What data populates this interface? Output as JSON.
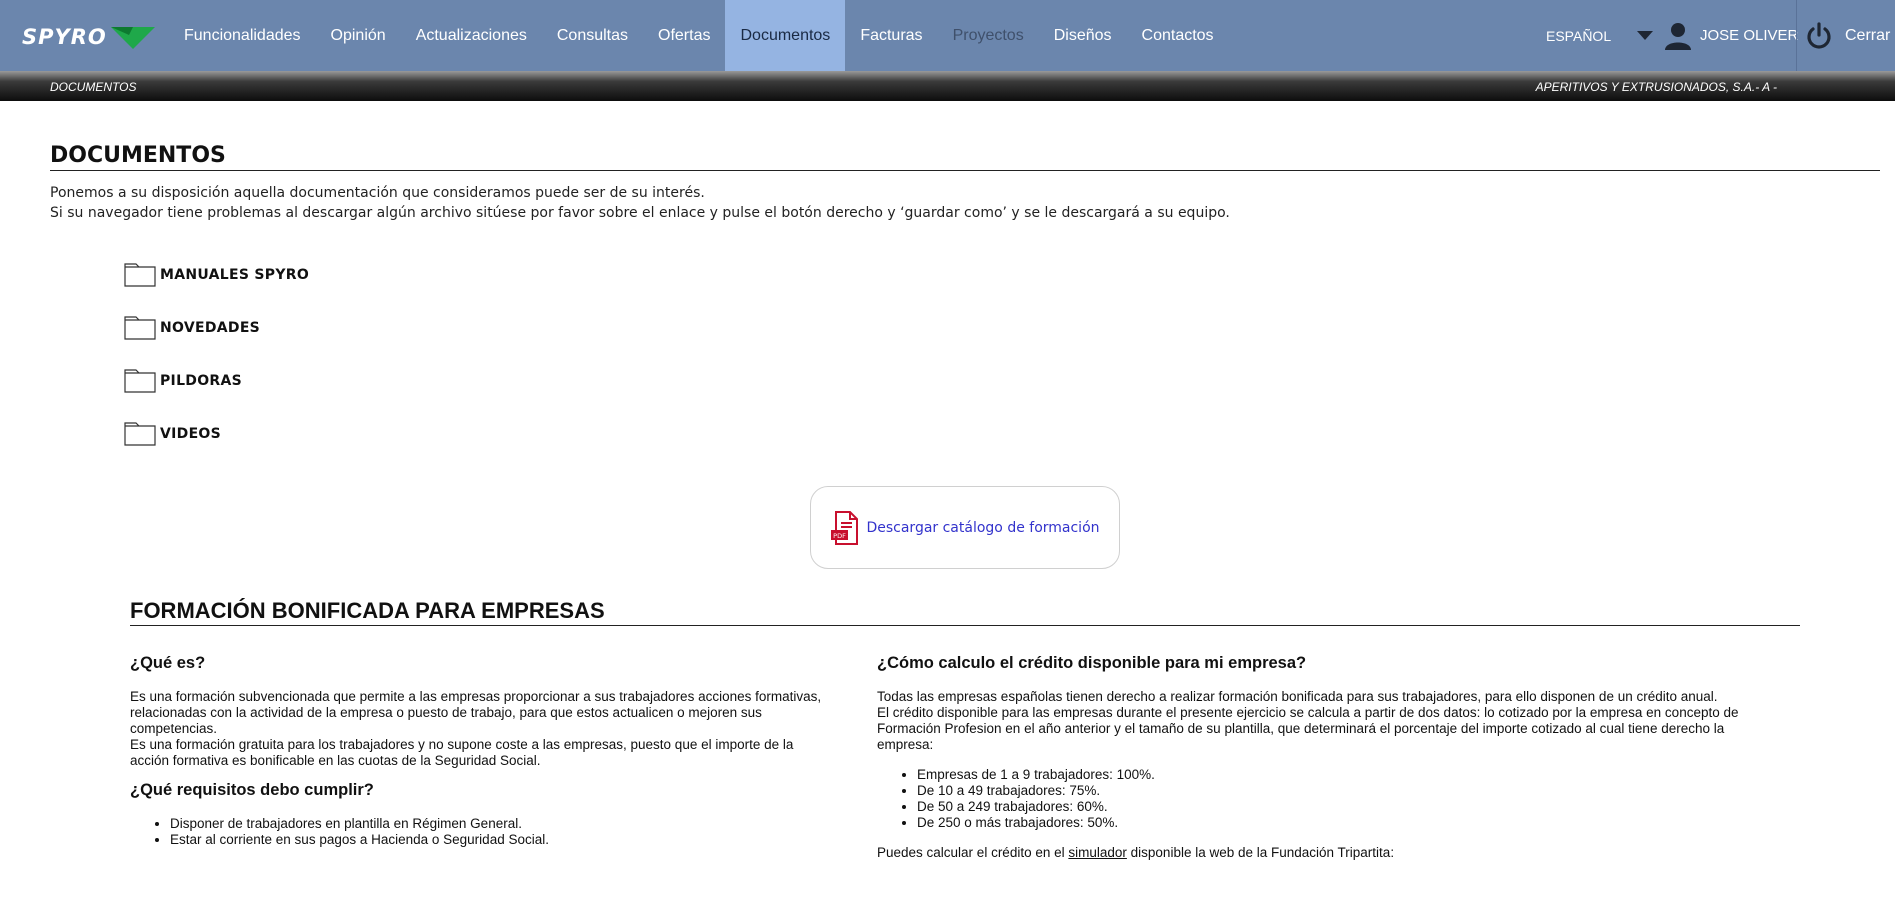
{
  "header": {
    "logo_text": "SPYRO",
    "nav": [
      {
        "label": "Funcionalidades"
      },
      {
        "label": "Opinión"
      },
      {
        "label": "Actualizaciones"
      },
      {
        "label": "Consultas"
      },
      {
        "label": "Ofertas"
      },
      {
        "label": "Documentos",
        "active": true
      },
      {
        "label": "Facturas"
      },
      {
        "label": "Proyectos",
        "muted": true
      },
      {
        "label": "Diseños"
      },
      {
        "label": "Contactos"
      }
    ],
    "language": "ESPAÑOL",
    "user_name": "JOSE OLIVER",
    "logout_label": "Cerrar"
  },
  "strip": {
    "section": "DOCUMENTOS",
    "company": "APERITIVOS Y EXTRUSIONADOS, S.A.- A -"
  },
  "page": {
    "title": "DOCUMENTOS",
    "intro_line1": "Ponemos a su disposición aquella documentación que consideramos puede ser de su interés.",
    "intro_line2": "Si su navegador tiene problemas al descargar algún archivo sitúese por favor sobre el enlace y pulse el botón derecho y ‘guardar como’ y se le descargará a su equipo."
  },
  "folders": [
    "MANUALES SPYRO",
    "NOVEDADES",
    "PILDORAS",
    "VIDEOS"
  ],
  "download": {
    "icon": "pdf-icon",
    "label": "Descargar catálogo de formación"
  },
  "formacion": {
    "title": "FORMACIÓN BONIFICADA PARA EMPRESAS",
    "left": {
      "q1": "¿Qué es?",
      "p1": "Es una formación subvencionada que permite a las empresas proporcionar a sus trabajadores acciones formativas, relacionadas con la actividad de la empresa o puesto de trabajo, para que estos actualicen o mejoren sus competencias.",
      "p2": "Es una formación gratuita para los trabajadores y no supone coste a las empresas, puesto que el importe de la acción formativa es bonificable en las cuotas de la Seguridad Social.",
      "q2": "¿Qué requisitos debo cumplir?",
      "requirements": [
        "Disponer de trabajadores en plantilla en Régimen General.",
        "Estar al corriente en sus pagos a Hacienda o Seguridad Social."
      ]
    },
    "right": {
      "q1": "¿Cómo calculo el crédito disponible para mi empresa?",
      "p1": "Todas las empresas españolas tienen derecho a realizar formación bonificada para sus trabajadores, para ello disponen de un crédito anual.",
      "p2": "El crédito disponible para las empresas durante el presente ejercicio se calcula a partir de dos datos: lo cotizado por la empresa en concepto de Formación Profesion en el año anterior y el tamaño de su plantilla, que determinará el porcentaje del importe cotizado al cual tiene derecho la empresa:",
      "tiers": [
        "Empresas de 1 a 9 trabajadores: 100%.",
        "De 10 a 49 trabajadores: 75%.",
        "De 50 a 249 trabajadores: 60%.",
        "De 250 o más trabajadores: 50%."
      ],
      "calc_before": "Puedes calcular el crédito en el ",
      "calc_link": "simulador",
      "calc_after": " disponible la web de la Fundación Tripartita:"
    }
  },
  "colors": {
    "nav_bg": "#6b86ad",
    "nav_active_bg": "#95b4e2",
    "logo_green": "#1fa84a",
    "link_blue": "#3333cc",
    "pdf_red": "#c8102e"
  }
}
